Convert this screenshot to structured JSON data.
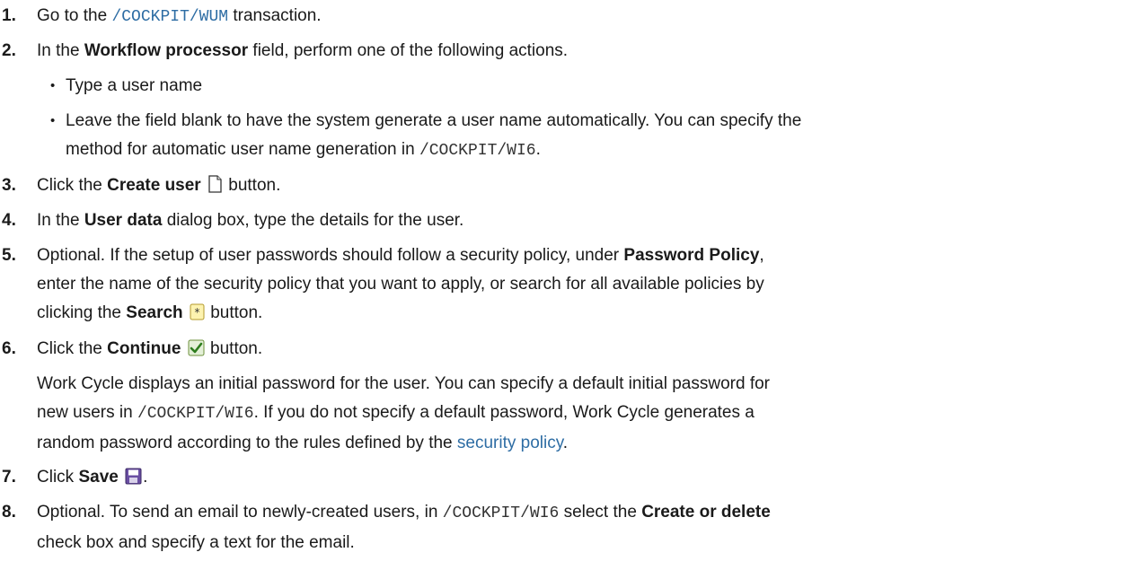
{
  "steps": [
    {
      "number": "1.",
      "pre": "Go to the ",
      "code": "/COCKPIT/WUM",
      "post": " transaction."
    },
    {
      "number": "2.",
      "pre": "In the ",
      "bold": "Workflow processor",
      "post": " field, perform one of the following actions.",
      "bullets": [
        {
          "text": "Type a user name"
        },
        {
          "line1": "Leave the field blank to have the system generate a user name automatically. You can specify the",
          "line2_pre": "method for automatic user name generation in ",
          "line2_code": "/COCKPIT/WI6",
          "line2_post": "."
        }
      ]
    },
    {
      "number": "3.",
      "pre": "Click the ",
      "bold": "Create user",
      "icon": "create-document-icon",
      "post": " button."
    },
    {
      "number": "4.",
      "pre": "In the ",
      "bold": "User data",
      "post": " dialog box, type the details for the user."
    },
    {
      "number": "5.",
      "line1_pre": "Optional. If the setup of user passwords should follow a security policy, under ",
      "line1_bold": "Password Policy",
      "line1_post": ",",
      "line2": "enter the name of the security policy that you want to apply, or search for all available policies by",
      "line3_pre": "clicking the ",
      "line3_bold": "Search",
      "icon": "search-asterisk-icon",
      "line3_post": " button."
    },
    {
      "number": "6.",
      "pre": "Click the ",
      "bold": "Continue",
      "icon": "continue-check-icon",
      "post": " button.",
      "continuation": {
        "line1": "Work Cycle displays an initial password for the user. You can specify a default initial password for",
        "line2_pre": "new users in ",
        "line2_code": "/COCKPIT/WI6",
        "line2_post": ". If you do not specify a default password, Work Cycle generates a",
        "line3_pre": "random password according to the rules defined by the ",
        "line3_link": "security policy",
        "line3_post": "."
      }
    },
    {
      "number": "7.",
      "pre": "Click ",
      "bold": "Save",
      "icon": "save-floppy-icon",
      "post": "."
    },
    {
      "number": "8.",
      "line1_pre": "Optional. To send an email to newly-created users, in ",
      "line1_code": "/COCKPIT/WI6",
      "line1_mid": " select the ",
      "line1_bold": "Create or delete",
      "line2": "check box and specify a text for the email."
    }
  ],
  "colors": {
    "link": "#2e6da4",
    "text": "#1a1a1a"
  }
}
